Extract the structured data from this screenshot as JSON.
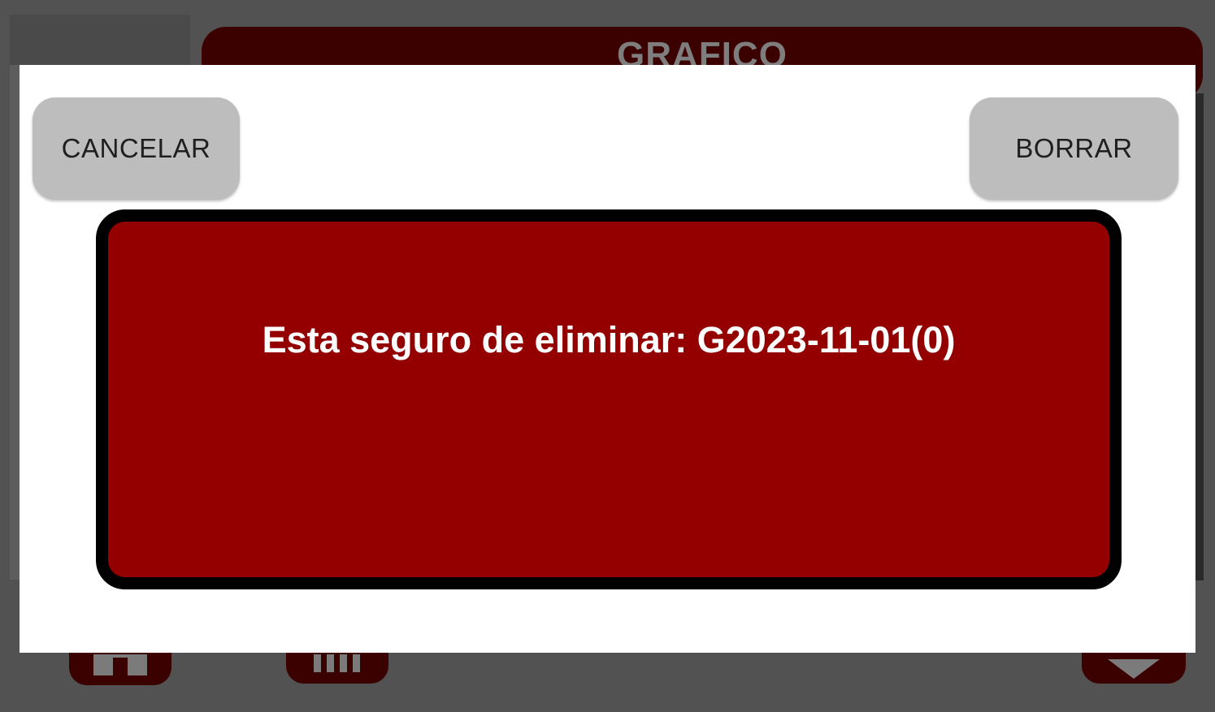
{
  "background": {
    "title": "GRAFICO",
    "nav": {
      "home_icon": "home-icon",
      "chart_icon": "bar-chart-icon",
      "down_icon": "chevron-down-icon"
    }
  },
  "dialog": {
    "cancel_label": "CANCELAR",
    "delete_label": "BORRAR",
    "message": "Esta seguro de eliminar: G2023-11-01(0)"
  },
  "colors": {
    "overlay": "#525252",
    "title_bar": "#3b0000",
    "message_bg": "#940000",
    "button_bg": "#bdbdbd",
    "dialog_bg": "#ffffff"
  }
}
